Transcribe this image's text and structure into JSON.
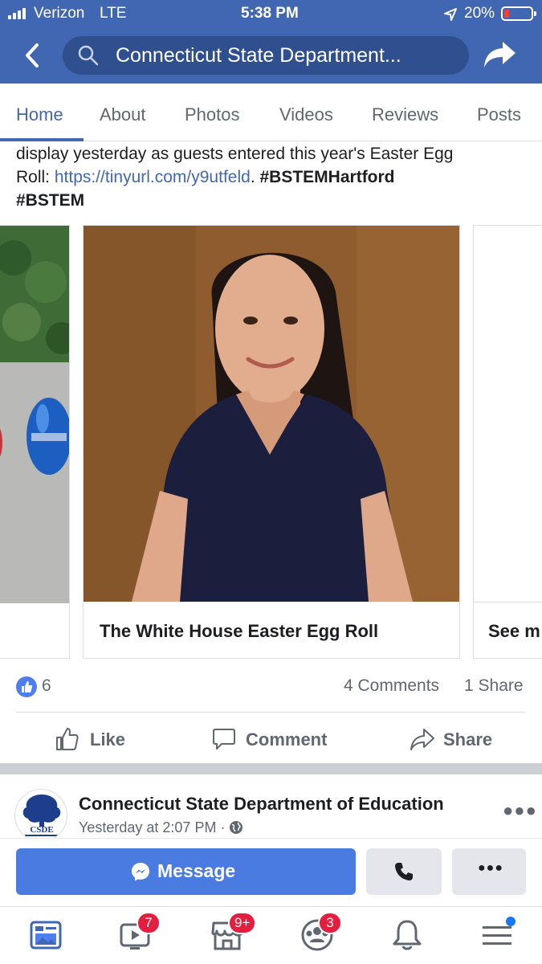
{
  "status_bar": {
    "carrier": "Verizon",
    "network": "LTE",
    "time": "5:38 PM",
    "battery": "20%",
    "battery_level": 0.2
  },
  "header": {
    "search_text": "Connecticut State Department..."
  },
  "tabs": [
    {
      "label": "Home",
      "active": true
    },
    {
      "label": "About"
    },
    {
      "label": "Photos"
    },
    {
      "label": "Videos"
    },
    {
      "label": "Reviews"
    },
    {
      "label": "Posts"
    }
  ],
  "post": {
    "text_line1": "display yesterday as guests entered this year's Easter Egg",
    "text_line2_prefix": "Roll: ",
    "link": "https://tinyurl.com/y9utfeld",
    "text_line2_dot": ".",
    "hashtag1": "#BSTEMHartford",
    "hashtag2": "#BSTEM"
  },
  "carousel": {
    "center_title": "The White House Easter Egg Roll",
    "right_title": "See m"
  },
  "stats": {
    "likes": "6",
    "comments": "4 Comments",
    "shares": "1 Share"
  },
  "actions": {
    "like": "Like",
    "comment": "Comment",
    "share": "Share"
  },
  "next_post": {
    "page_name": "Connecticut State Department of Education",
    "time": "Yesterday at 2:07 PM · ",
    "avatar_text": "CSDE"
  },
  "message_bar": {
    "message_label": "Message"
  },
  "bottom_nav": {
    "badges": {
      "watch": "7",
      "marketplace": "9+",
      "groups": "3"
    }
  },
  "colors": {
    "brand_blue": "#4267b2",
    "badge_red": "#e41e3f",
    "message_blue": "#4a7be0"
  }
}
